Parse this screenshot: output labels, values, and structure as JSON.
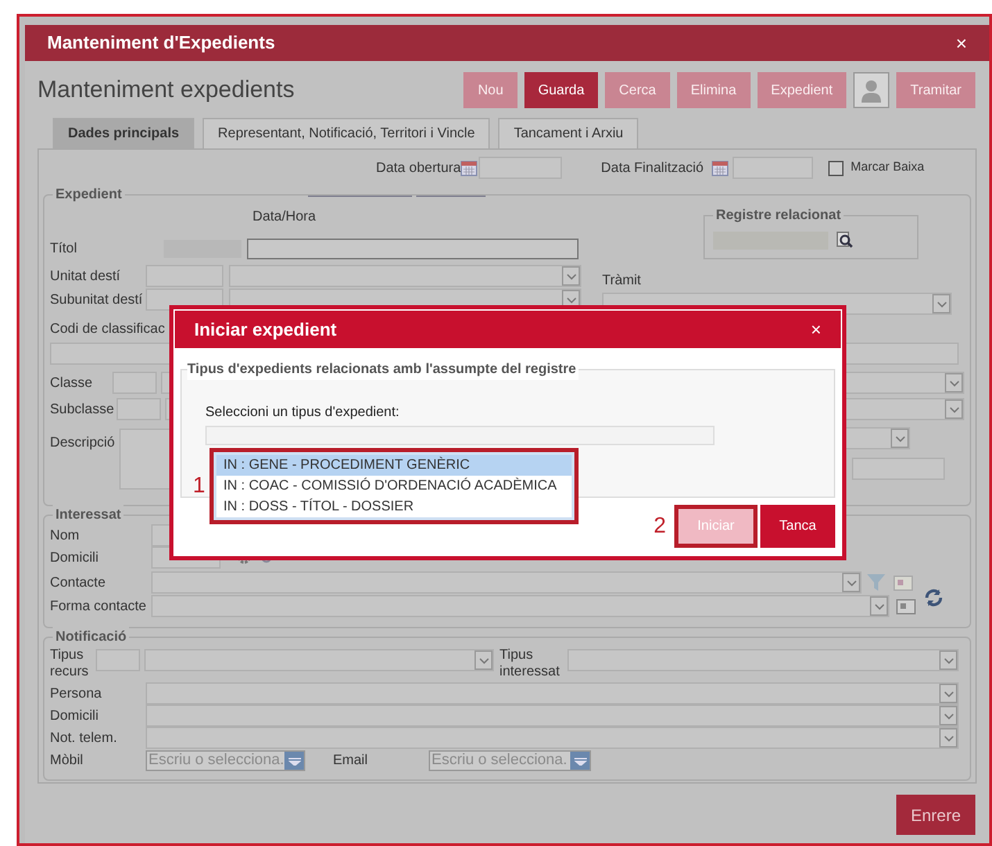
{
  "window": {
    "title": "Manteniment d'Expedients",
    "close": "×"
  },
  "page_title": "Manteniment expedients",
  "toolbar": [
    {
      "kind": "button",
      "label": "Nou",
      "selected": false
    },
    {
      "kind": "button",
      "label": "Guarda",
      "selected": true
    },
    {
      "kind": "button",
      "label": "Cerca",
      "selected": false
    },
    {
      "kind": "button",
      "label": "Elimina",
      "selected": false
    },
    {
      "kind": "button",
      "label": "Expedient",
      "selected": false
    },
    {
      "kind": "icon",
      "selected": false
    },
    {
      "kind": "button",
      "label": "Tramitar",
      "selected": false
    }
  ],
  "tabs": [
    {
      "label": "Dades principals",
      "selected": true
    },
    {
      "label": "Representant, Notificació, Territori i Vincle",
      "selected": false
    },
    {
      "label": "Tancament i Arxiu",
      "selected": false
    }
  ],
  "dates": {
    "opening_label": "Data obertura",
    "closing_label": "Data Finalització",
    "checkbox_label": "Marcar Baixa",
    "checked": false
  },
  "expedient": {
    "legend": "Expedient",
    "datetime_label": "Data/Hora",
    "register_legend": "Registre relacionat",
    "title_label": "Títol",
    "unit_label": "Unitat destí",
    "subunit_label": "Subunitat destí",
    "procedure_label": "Tràmit",
    "classification_label": "Codi de classificac",
    "class_label": "Classe",
    "subclass_label": "Subclasse",
    "description_label": "Descripció"
  },
  "interested": {
    "legend": "Interessat",
    "name_label": "Nom",
    "address_label": "Domicili",
    "contact_label": "Contacte",
    "contact_form_label": "Forma contacte"
  },
  "notification": {
    "legend": "Notificació",
    "resource_type_label": "Tipus recurs",
    "interested_type_label": "Tipus interessat",
    "person_label": "Persona",
    "address_label": "Domicili",
    "telematic_label": "Not. telem.",
    "mobile_label": "Mòbil",
    "mobile_placeholder": "Escriu o selecciona.",
    "email_label": "Email",
    "email_placeholder": "Escriu o selecciona."
  },
  "back_button": "Enrere",
  "dialog": {
    "title": "Iniciar expedient",
    "close": "×",
    "legend": "Tipus d'expedients relacionats amb l'assumpte del registre",
    "select_label": "Seleccioni un tipus d'expedient:",
    "options": [
      {
        "label": "IN : GENE - PROCEDIMENT GENÈRIC",
        "selected": true
      },
      {
        "label": "IN : COAC - COMISSIÓ D'ORDENACIÓ ACADÈMICA",
        "selected": false
      },
      {
        "label": "IN : DOSS - TÍTOL - DOSSIER",
        "selected": false
      }
    ],
    "list_marker": "1",
    "button_marker": "2",
    "buttons": [
      {
        "label": "Iniciar",
        "disabled": true
      },
      {
        "label": "Tanca",
        "disabled": false
      }
    ]
  }
}
